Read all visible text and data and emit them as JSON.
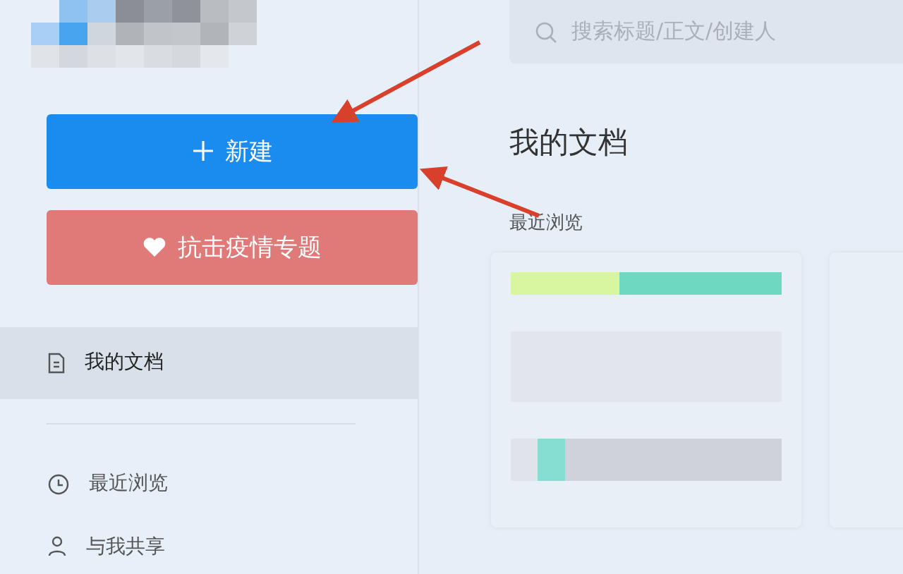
{
  "sidebar": {
    "new_button": {
      "label": "新建"
    },
    "topic_button": {
      "label": "抗击疫情专题"
    },
    "nav_items": [
      {
        "kind": "document",
        "label": "我的文档",
        "selected": true
      },
      {
        "kind": "clock",
        "label": "最近浏览",
        "selected": false
      },
      {
        "kind": "person",
        "label": "与我共享",
        "selected": false
      }
    ]
  },
  "main": {
    "search": {
      "placeholder": "搜索标题/正文/创建人"
    },
    "title": "我的文档",
    "section_label": "最近浏览"
  }
}
